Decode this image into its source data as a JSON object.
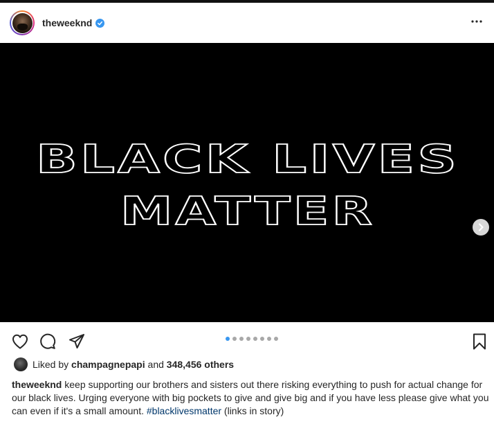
{
  "post": {
    "username": "theweeknd",
    "verified": true,
    "more_label": "···",
    "media": {
      "headline_line1": "BLACK LIVES",
      "headline_line2": "MATTER",
      "background": "#000000",
      "outline_color": "#ffffff"
    },
    "carousel": {
      "slides": 8,
      "active_index": 0
    },
    "likes": {
      "prefix": "Liked by",
      "liker": "champagnepapi",
      "connector": "and",
      "others": "348,456 others"
    },
    "caption": {
      "user": "theweeknd",
      "text": "keep supporting our brothers and sisters out there risking everything to push for actual change for our black lives. Urging everyone with big pockets to give and give big and if you have less please give what you can even if it's a small amount.",
      "hashtag": "#blacklivesmatter",
      "suffix": "(links in story)"
    }
  },
  "icons": {
    "verified": "verified-badge-icon",
    "more": "more-options-icon",
    "next": "chevron-right-icon",
    "like": "heart-icon",
    "comment": "comment-icon",
    "share": "paper-plane-icon",
    "save": "bookmark-icon"
  },
  "colors": {
    "accent": "#3897f0",
    "text": "#262626",
    "hashtag": "#00376b",
    "dot_inactive": "#a8a8a8"
  }
}
